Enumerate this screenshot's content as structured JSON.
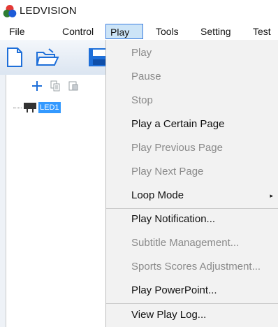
{
  "app": {
    "title": "LEDVISION"
  },
  "menubar": {
    "items": [
      {
        "label": "File"
      },
      {
        "label": "Control"
      },
      {
        "label": "Play"
      },
      {
        "label": "Tools"
      },
      {
        "label": "Setting"
      },
      {
        "label": "Test"
      }
    ],
    "active": "Play"
  },
  "toolbar": {
    "icons": [
      "new-file-icon",
      "open-folder-icon",
      "save-icon"
    ]
  },
  "left_panel": {
    "tool_icons": [
      "add-icon",
      "copy-icon",
      "paste-icon"
    ],
    "tree": [
      {
        "label": "LED1",
        "selected": true
      }
    ]
  },
  "play_menu": {
    "items": [
      {
        "label": "Play",
        "enabled": false
      },
      {
        "label": "Pause",
        "enabled": false
      },
      {
        "label": "Stop",
        "enabled": false
      },
      {
        "label": "Play a Certain Page",
        "enabled": true
      },
      {
        "label": "Play Previous Page",
        "enabled": false
      },
      {
        "label": "Play Next Page",
        "enabled": false
      },
      {
        "label": "Loop Mode",
        "enabled": true,
        "submenu": true
      },
      {
        "label": "Play Notification...",
        "enabled": true
      },
      {
        "label": "Subtitle Management...",
        "enabled": false
      },
      {
        "label": "Sports Scores Adjustment...",
        "enabled": false
      },
      {
        "label": "Play PowerPoint...",
        "enabled": true
      },
      {
        "label": "View Play Log...",
        "enabled": true
      }
    ],
    "submenu_arrow": "▸"
  },
  "colors": {
    "menu_bg": "#f2f2f2",
    "selection": "#3399ff",
    "active_menu": "#cce4f7",
    "disabled_text": "#8a8a8a"
  }
}
